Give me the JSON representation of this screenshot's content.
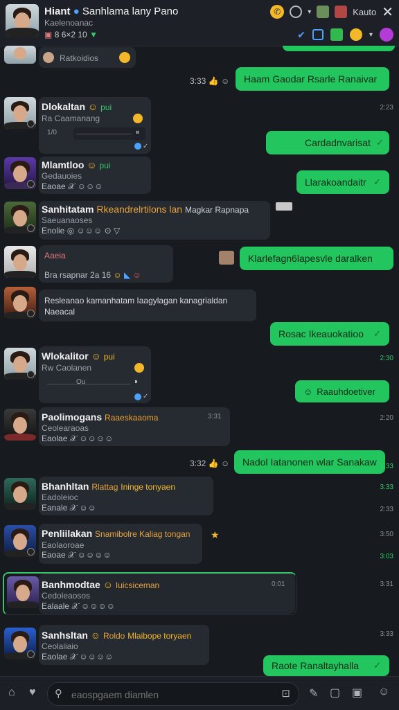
{
  "header": {
    "name": "Hiant",
    "title_rest": "Sanhlama lany Pano",
    "subtitle": "Kaelenoanac",
    "meta": "8   6×2 10",
    "user_label": "Kauto",
    "icons": [
      "phone-icon",
      "clock-icon",
      "chevron-down-icon",
      "close-icon",
      "check-icon",
      "share-icon",
      "emoji-icon"
    ]
  },
  "messages": [
    {
      "sub": "Ratkoidios"
    },
    {
      "text": "Haam Gaodar Rsarle Ranaivar",
      "time": "3:23"
    },
    {
      "name": "Dlokaltan",
      "tag": "pui",
      "sub": "Ra Caamanang",
      "time": "2:23",
      "play_a": "1/0",
      "play_b": "1:1"
    },
    {
      "text": "Cardadnvarisat",
      "time": ""
    },
    {
      "name": "Mlamtloo",
      "tag": "pui",
      "sub": "Gedauoies",
      "reac": "Eaoae   𝒳 ☺☺☺",
      "time": ""
    },
    {
      "text": "Llarakoandaitr",
      "time": ""
    },
    {
      "name": "Sanhitatam",
      "tag": "Rkeandrelrtilons lan",
      "tag2": "Magkar Rapnapa",
      "sub": "Saeuanaoses",
      "reac": "Enolie   ◎ ☺☺☺ ⊙ ▽",
      "time": ""
    },
    {
      "sub": "Aaeia",
      "reac": "Bra rsapnar 2a 16",
      "time": ""
    },
    {
      "text": "Klarlefagn6lapesvle daralken",
      "time": ""
    },
    {
      "text": "Resleanao kamanhatam Iaagylagan kanagrialdan Naeacal",
      "time": ""
    },
    {
      "text": "Rosac Ikeauokatioo",
      "time": "2:30"
    },
    {
      "name": "Wlokalitor",
      "tag": "pui",
      "sub": "Rw Caolanen",
      "time": "",
      "play_a": "Ou",
      "play_b": ""
    },
    {
      "text": "Raauhdoetiver",
      "time": "2:30"
    },
    {
      "name": "Paolimogans",
      "tag": "Raaeskaaoma",
      "sub": "Ceolearaoas",
      "reac": "Eaolae   𝒳 ☺☺☺☺",
      "time": "3:31",
      "time2": "2:20"
    },
    {
      "text": "Nadol Iatanonen wlar Sanakaw",
      "time": "2:33"
    },
    {
      "name": "Bhanhltan",
      "tag": "Rlattag",
      "tag2": "Ininge tonyaen",
      "sub": "Eadoleioc",
      "reac": "Eanale   𝒳 ☺☺",
      "time": "3:33",
      "time2": "2:33"
    },
    {
      "name": "Penliilakan",
      "tag2": "Snamibolre Kaliag tongan",
      "sub": "Eaolaoroae",
      "reac": "Eaoae   𝒳 ☺☺☺☺",
      "time": "3:50",
      "time2": "3:03"
    },
    {
      "name": "Banhmodtae",
      "tag": "Iuicsiceman",
      "sub": "Cedoleaosos",
      "reac": "Ealaale   𝒳 ☺☺☺☺",
      "time": "0:01",
      "time2": "3:31"
    },
    {
      "name": "Sanhsltan",
      "tag": "Roldo",
      "tag2": "Mlaibope toryaen",
      "sub": "Ceolaiiaio",
      "reac": "Eaolae   𝒳 ☺☺☺☺",
      "time": "3:33"
    },
    {
      "text": "Raote Ranaltayhalla",
      "time": "3:31"
    }
  ],
  "composer": {
    "placeholder": "eaospgaem diamlen"
  },
  "colors": {
    "bg": "#171a1f",
    "bubble_in": "#262a31",
    "bubble_out": "#22c55e",
    "accent": "#e8a33a"
  }
}
